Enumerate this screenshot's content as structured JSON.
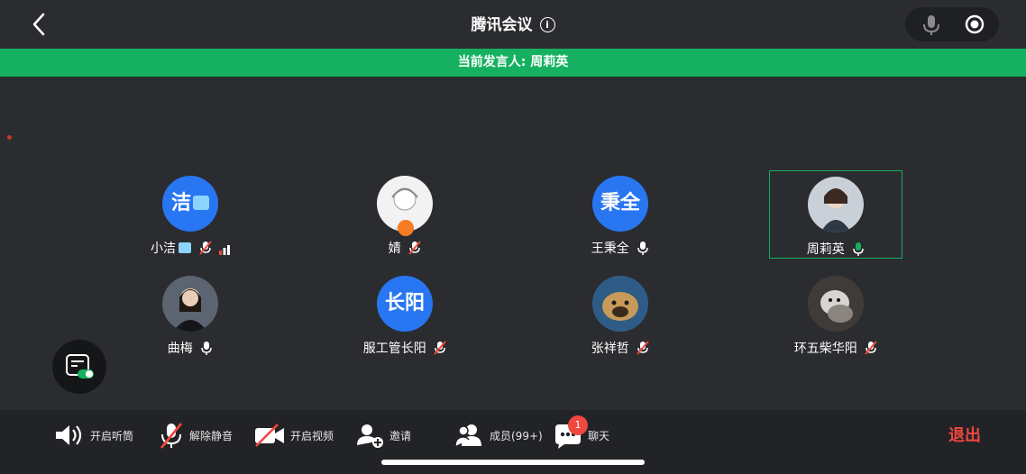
{
  "header": {
    "title": "腾讯会议"
  },
  "speaker": {
    "label": "当前发言人: 周莉英"
  },
  "participants": [
    {
      "name": "小洁",
      "avatar_text": "洁",
      "mic": "muted",
      "signal": "weak"
    },
    {
      "name": "婧",
      "avatar_text": "",
      "mic": "muted"
    },
    {
      "name": "王秉全",
      "avatar_text": "秉全",
      "mic": "on"
    },
    {
      "name": "周莉英",
      "avatar_text": "",
      "mic": "speaking"
    },
    {
      "name": "曲梅",
      "avatar_text": "",
      "mic": "on"
    },
    {
      "name": "服工管长阳",
      "avatar_text": "长阳",
      "mic": "muted"
    },
    {
      "name": "张祥哲",
      "avatar_text": "",
      "mic": "muted"
    },
    {
      "name": "环五柴华阳",
      "avatar_text": "",
      "mic": "muted"
    }
  ],
  "toolbar": {
    "audio": "开启听筒",
    "unmute": "解除静音",
    "video": "开启视频",
    "invite": "邀请",
    "members": "成员(99+)",
    "chat": "聊天",
    "chat_badge": "1",
    "exit": "退出"
  },
  "colors": {
    "accent_green": "#15b160",
    "avatar_blue": "#2876f2",
    "danger_red": "#f0473f"
  }
}
